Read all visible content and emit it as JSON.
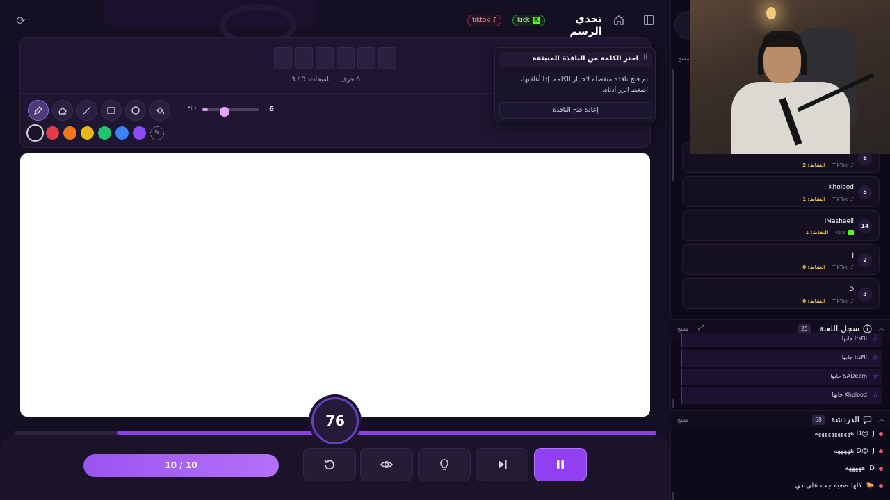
{
  "header": {
    "title": "تحدي الرسم",
    "kick_label": "kick",
    "tiktok_label": "tiktok"
  },
  "word": {
    "letters_label": "6 حرف",
    "hints_label": "تلميحات: 0 / 3",
    "slot_count": 6
  },
  "tools": {
    "brush_size": "6",
    "colors": [
      "#1a1428",
      "#e23b4a",
      "#f07a1a",
      "#e6b817",
      "#22c56b",
      "#3b82f6",
      "#8b4cf0"
    ],
    "selected_color": "#1a1428"
  },
  "popup": {
    "title": "اختر الكلمة من النافذة المنبثقة",
    "text": "تم فتح نافذة منفصلة لاختيار الكلمة. إذا أغلقتها، اضغط الزر أدناه.",
    "button": "إعادة فتح النافذة"
  },
  "timer": {
    "value": "76",
    "progress": 0.84
  },
  "controls": {
    "round_label": "10 / 10"
  },
  "sidebar": {
    "clear_label": "مسح",
    "leaderboard": [
      {
        "rank": "6",
        "name": "",
        "platform": "TikTok",
        "points": "النقاط: 2"
      },
      {
        "rank": "5",
        "name": "Kholood",
        "platform": "TikTok",
        "points": "النقاط: 1"
      },
      {
        "rank": "14",
        "name": "IMashaell",
        "platform": "Kick",
        "points": "النقاط: 1"
      },
      {
        "rank": "2",
        "name": "J",
        "platform": "TikTok",
        "points": "النقاط: 0"
      },
      {
        "rank": "3",
        "name": "D",
        "platform": "TikTok",
        "points": "النقاط: 0"
      }
    ],
    "log": {
      "title": "سجل اللعبة",
      "count": "25",
      "entries": [
        "itsFii جابها",
        "itsFii جابها",
        "SADeem جابها",
        "Kholood جابها"
      ]
    },
    "chat": {
      "title": "الدردشة",
      "count": "68",
      "messages": [
        {
          "user": "J",
          "text": "@D هههههههههههه"
        },
        {
          "user": "J",
          "text": "@D هههههه"
        },
        {
          "user": "D",
          "text": "هههههه"
        },
        {
          "user": "🐎",
          "text": "كلها صعبه جت على ذي"
        }
      ]
    }
  }
}
